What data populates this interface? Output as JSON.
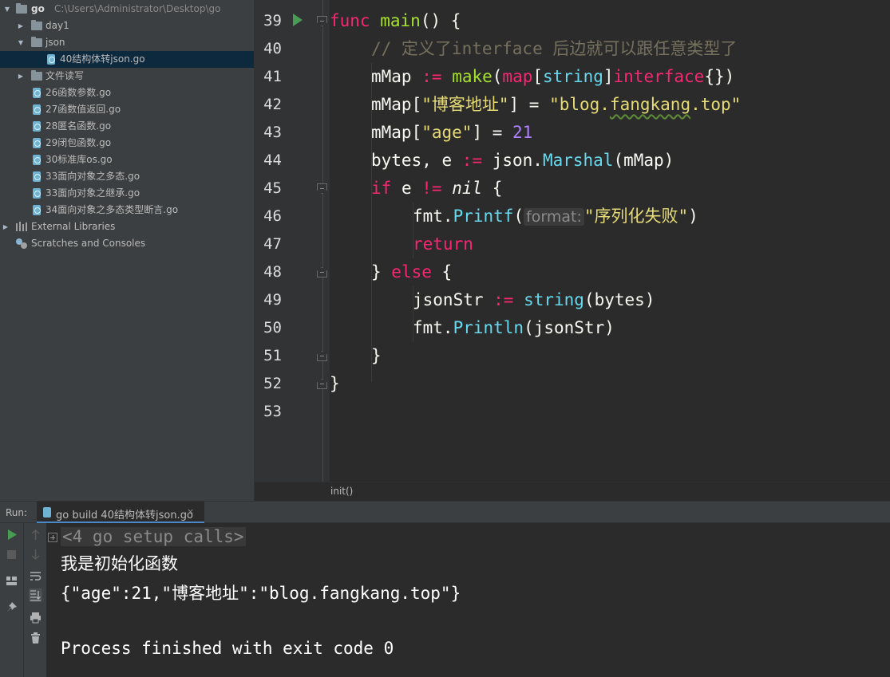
{
  "sidebar": {
    "root": {
      "name": "go",
      "path": "C:\\Users\\Administrator\\Desktop\\go"
    },
    "items": [
      {
        "label": "day1"
      },
      {
        "label": "json"
      },
      {
        "label": "40结构体转json.go"
      },
      {
        "label": "文件读写"
      },
      {
        "label": "26函数参数.go"
      },
      {
        "label": "27函数值返回.go"
      },
      {
        "label": "28匿名函数.go"
      },
      {
        "label": "29闭包函数.go"
      },
      {
        "label": "30标准库os.go"
      },
      {
        "label": "33面向对象之多态.go"
      },
      {
        "label": "33面向对象之继承.go"
      },
      {
        "label": "34面向对象之多态类型断言.go"
      },
      {
        "label": "External Libraries"
      },
      {
        "label": "Scratches and Consoles"
      }
    ]
  },
  "editor": {
    "line_numbers": [
      "39",
      "40",
      "41",
      "42",
      "43",
      "44",
      "45",
      "46",
      "47",
      "48",
      "49",
      "50",
      "51",
      "52",
      "53"
    ],
    "code": {
      "l39_func": "func",
      "l39_main": "main",
      "l39_rest": "() {",
      "l40_comment": "// 定义了interface 后边就可以跟任意类型了",
      "l41_var": "mMap",
      "l41_op": ":=",
      "l41_make": "make",
      "l41_map": "map",
      "l41_string": "string",
      "l41_iface": "interface",
      "l41_tail": "{})",
      "l42_var": "mMap[",
      "l42_key": "\"博客地址\"",
      "l42_mid": "] = ",
      "l42_val_a": "\"blog.",
      "l42_val_b": "fangkang",
      "l42_val_c": ".top\"",
      "l43_var": "mMap[",
      "l43_key": "\"age\"",
      "l43_mid": "] = ",
      "l43_val": "21",
      "l44_vars": "bytes, e ",
      "l44_op": ":=",
      "l44_pkg": " json.",
      "l44_fn": "Marshal",
      "l44_arg": "(mMap)",
      "l45_if": "if",
      "l45_e": " e ",
      "l45_op": "!=",
      "l45_nil": "nil",
      "l45_brace": " {",
      "l46_pkg": "fmt.",
      "l46_fn": "Printf",
      "l46_open": "(",
      "l46_hint": "format:",
      "l46_str": "\"序列化失败\"",
      "l46_close": ")",
      "l47_return": "return",
      "l48_close": "} ",
      "l48_else": "else",
      "l48_open": " {",
      "l49_var": "jsonStr ",
      "l49_op": ":=",
      "l49_string": " string",
      "l49_arg": "(bytes)",
      "l50_pkg": "fmt.",
      "l50_fn": "Println",
      "l50_arg": "(jsonStr)",
      "l51": "}",
      "l52": "}"
    },
    "breadcrumb": "init()"
  },
  "run": {
    "label": "Run:",
    "tab": "go build 40结构体转json.go",
    "close": "×",
    "console": {
      "setup": "<4 go setup calls>",
      "line1": "我是初始化函数",
      "line2": "{\"age\":21,\"博客地址\":\"blog.fangkang.top\"}",
      "line3": "Process finished with exit code 0"
    }
  },
  "colors": {
    "sidebar_bg": "#3c3f41",
    "editor_bg": "#2b2b2b",
    "selection": "#0d293e",
    "run_green": "#499c54"
  }
}
